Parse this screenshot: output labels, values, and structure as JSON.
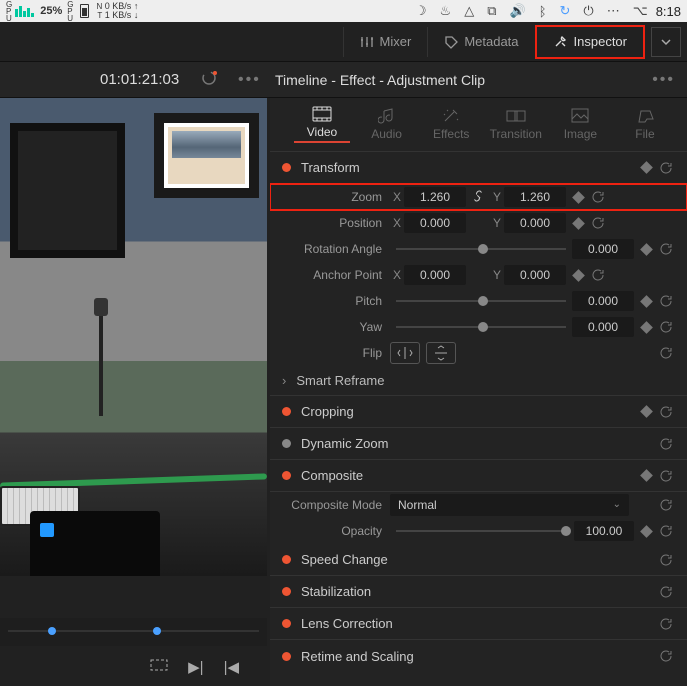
{
  "menubar": {
    "cpu_pct": "25%",
    "net_up": "0 KB/s",
    "net_down": "1 KB/s",
    "clock": "8:18"
  },
  "toppanel": {
    "mixer": "Mixer",
    "metadata": "Metadata",
    "inspector": "Inspector"
  },
  "header": {
    "timecode": "01:01:21:03",
    "title": "Timeline - Effect - Adjustment Clip"
  },
  "tabs": {
    "video": "Video",
    "audio": "Audio",
    "effects": "Effects",
    "transition": "Transition",
    "image": "Image",
    "file": "File"
  },
  "sections": {
    "transform": "Transform",
    "smart_reframe": "Smart Reframe",
    "cropping": "Cropping",
    "dynamic_zoom": "Dynamic Zoom",
    "composite": "Composite",
    "speed": "Speed Change",
    "stabilization": "Stabilization",
    "lens": "Lens Correction",
    "retime": "Retime and Scaling"
  },
  "transform": {
    "zoom_label": "Zoom",
    "zoom_x": "1.260",
    "zoom_y": "1.260",
    "position_label": "Position",
    "pos_x": "0.000",
    "pos_y": "0.000",
    "rotation_label": "Rotation Angle",
    "rotation": "0.000",
    "anchor_label": "Anchor Point",
    "anchor_x": "0.000",
    "anchor_y": "0.000",
    "pitch_label": "Pitch",
    "pitch": "0.000",
    "yaw_label": "Yaw",
    "yaw": "0.000",
    "flip_label": "Flip",
    "x": "X",
    "y": "Y"
  },
  "composite": {
    "mode_label": "Composite Mode",
    "mode_value": "Normal",
    "opacity_label": "Opacity",
    "opacity_value": "100.00"
  }
}
